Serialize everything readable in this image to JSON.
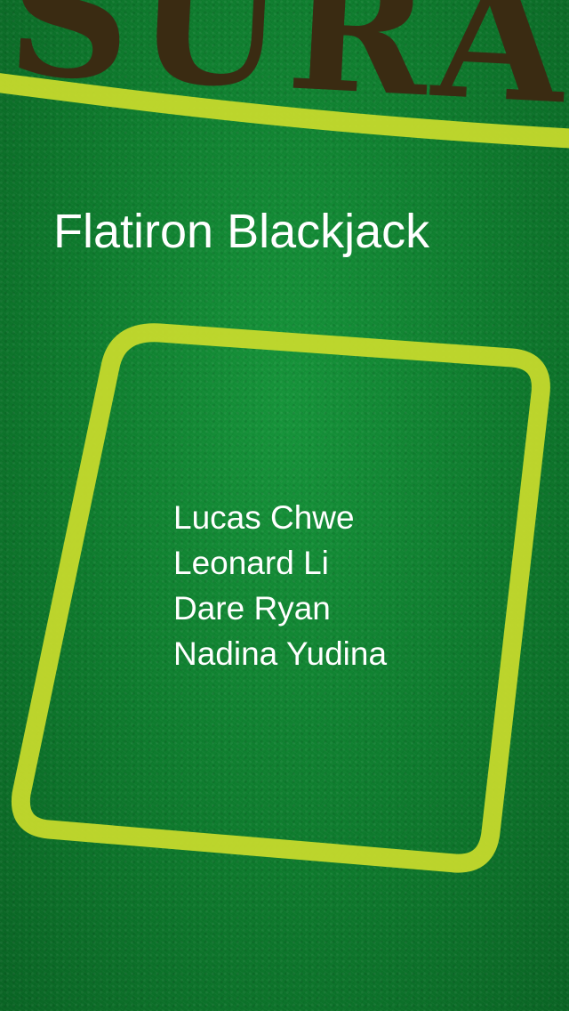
{
  "table": {
    "lettering": "SURA",
    "felt_color": "#0f7a2e",
    "line_color": "#c9dc2c",
    "lettering_color": "#3a2b12"
  },
  "header": {
    "title": "Flatiron Blackjack"
  },
  "players": [
    {
      "name": "Lucas Chwe"
    },
    {
      "name": "Leonard Li"
    },
    {
      "name": "Dare Ryan"
    },
    {
      "name": "Nadina Yudina"
    }
  ]
}
